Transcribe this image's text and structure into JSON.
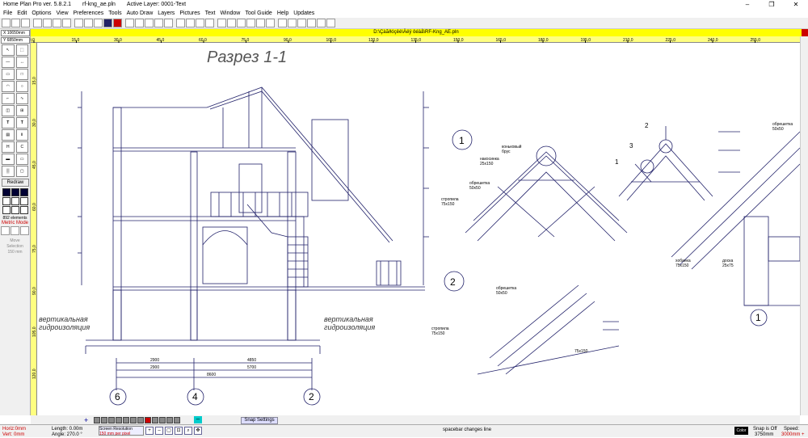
{
  "title": {
    "app": "Home Plan Pro ver. 5.8.2.1",
    "file": "rf-kng_ae.pln",
    "layer": "Active Layer: 0001-Text",
    "controls": [
      "–",
      "❐",
      "✕"
    ]
  },
  "menu": [
    "File",
    "Edit",
    "Options",
    "View",
    "Preferences",
    "Tools",
    "Auto Draw",
    "Layers",
    "Pictures",
    "Text",
    "Window",
    "Tool Guide",
    "Help",
    "Updates"
  ],
  "coords": {
    "x": "X 10650mm",
    "y": "Y 6850mm"
  },
  "palette": {
    "redraw": "Redraw",
    "elements": "892 elements",
    "metric": "Metric Mode",
    "move_selection": [
      "Move",
      "Selection",
      "150 mm"
    ]
  },
  "filebar": "D:\\Çàãðóçêè\\Äëÿ ôéäå\\RF-Kng_AE.pln",
  "ruler_top": [
    "0,0",
    "15,0",
    "30,0",
    "45,0",
    "60,0",
    "75,0",
    "90,0",
    "105,0",
    "120,0",
    "135,0",
    "150,0",
    "165,0",
    "180,0",
    "195,0",
    "210,0",
    "225,0",
    "240,0",
    "255,0"
  ],
  "ruler_left": [
    "15,0",
    "30,0",
    "45,0",
    "60,0",
    "75,0",
    "90,0",
    "105,0",
    "120,0"
  ],
  "drawing": {
    "title": "Разрез 1-1",
    "note_left": [
      "вертикальная",
      "гидроизоляция"
    ],
    "note_mid": [
      "вертикальная",
      "гидроизоляция"
    ],
    "axes": [
      "6",
      "4",
      "2"
    ],
    "circle_labels": [
      "1",
      "2",
      "1",
      "2",
      "3",
      "1"
    ],
    "dims": [
      "2900",
      "4850",
      "2900",
      "5700",
      "8600"
    ],
    "labels": [
      "коньковый",
      "брус",
      "накосинка",
      "25х150",
      "обрешетка",
      "50x50",
      "стропила",
      "75x150",
      "обрешетка",
      "50x50",
      "стропила",
      "75x150",
      "75x150",
      "обрешетка",
      "50x50",
      "доска",
      "25x75",
      "хобанка",
      "75x150"
    ]
  },
  "bottom": {
    "snap": "Snap Settings"
  },
  "status": {
    "horiz": "Horiz:0mm",
    "vert": "Vert: 0mm",
    "length": "Length: 0.00m",
    "angle": "Angle: 270.0 °",
    "res_label": "Screen Resolution",
    "res_value": "150 mm per pixel",
    "hint": "spacebar changes line",
    "color": "Color",
    "snap_label": "Snap is Off",
    "snap_value": "3750mm",
    "speed_label": "Speed:",
    "speed_value": "3000mm +"
  }
}
